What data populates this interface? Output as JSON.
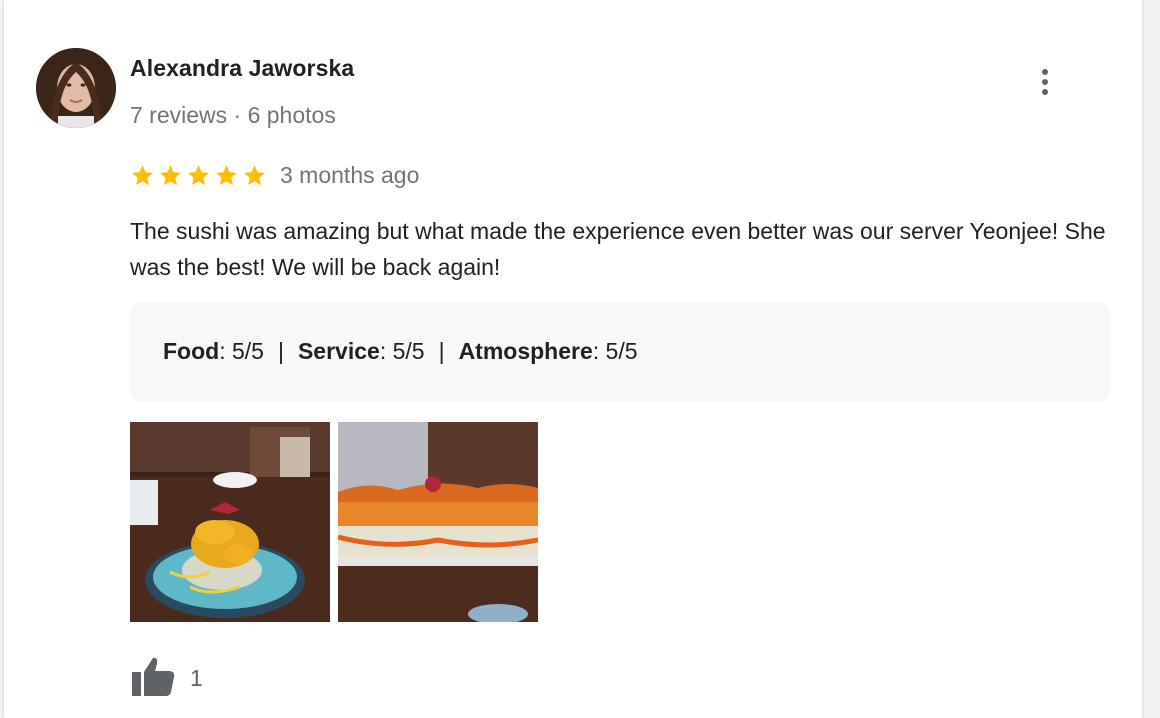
{
  "review": {
    "author": {
      "name": "Alexandra Jaworska",
      "meta": "7 reviews · 6 photos"
    },
    "rating": 5,
    "rating_max": 5,
    "date": "3 months ago",
    "text": "The sushi was amazing but what made the experience even better was our server Yeonjee! She was the best! We will be back again!",
    "aspects": [
      {
        "label": "Food",
        "value": ": 5/5"
      },
      {
        "label": "Service",
        "value": ": 5/5"
      },
      {
        "label": "Atmosphere",
        "value": ": 5/5"
      }
    ],
    "aspect_separator": "|",
    "likes": "1",
    "colors": {
      "star": "#fbbc04",
      "text": "#202124",
      "secondary": "#70757a",
      "aspect_bg": "#f7f8fa"
    },
    "icons": {
      "menu": "more-vert-icon",
      "star": "star-icon",
      "like": "thumb-up-icon"
    }
  }
}
